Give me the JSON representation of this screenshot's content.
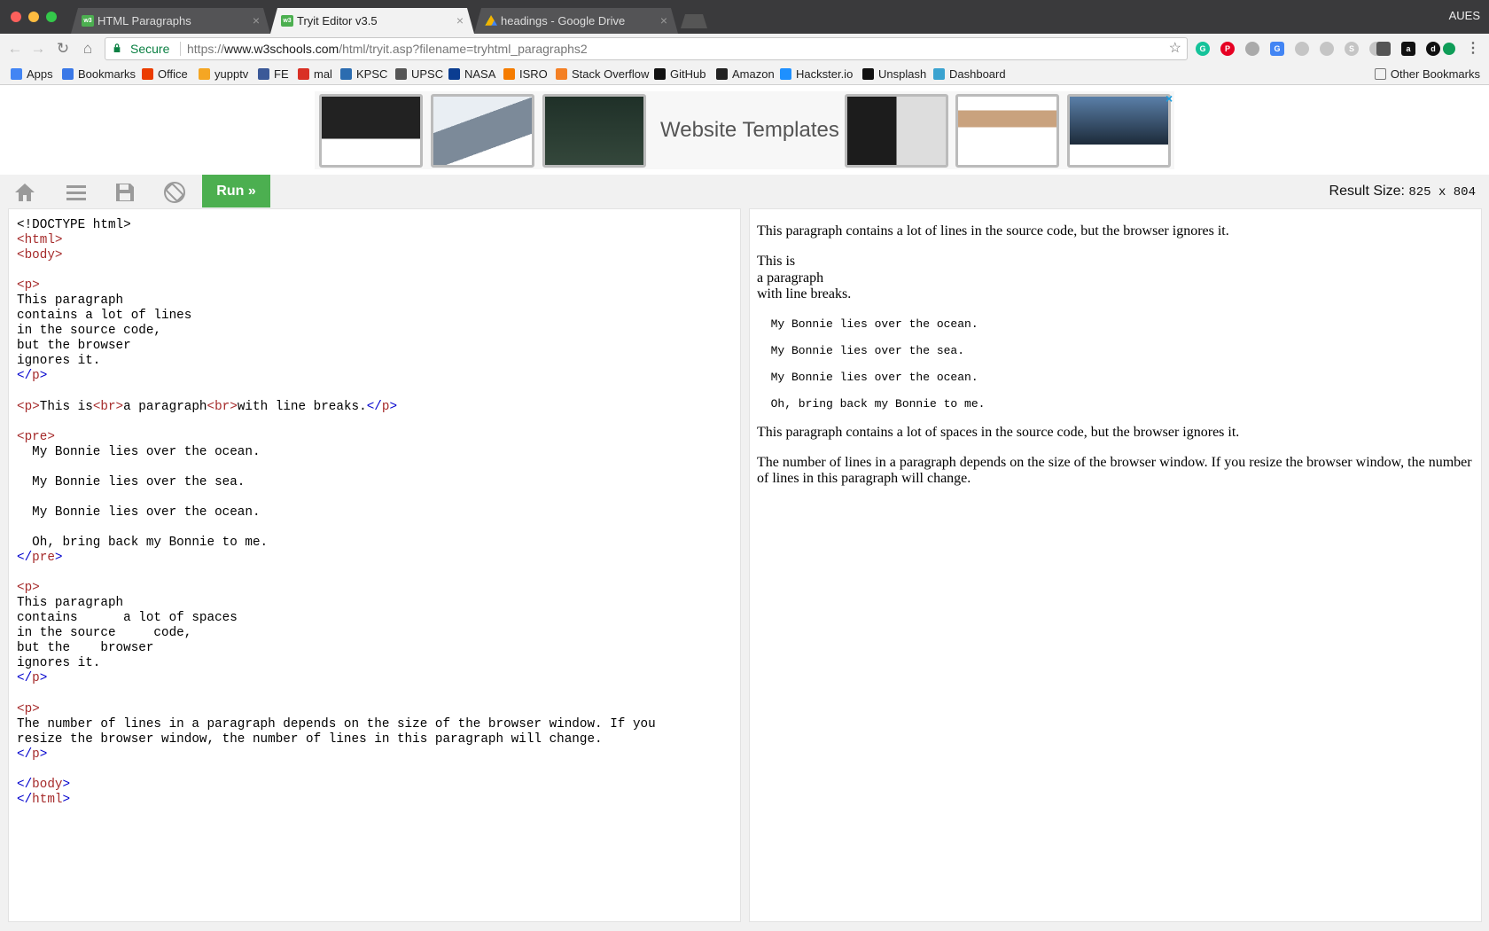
{
  "browser": {
    "tabs": [
      {
        "title": "HTML Paragraphs",
        "favicon": "w3schools-icon"
      },
      {
        "title": "Tryit Editor v3.5",
        "favicon": "w3schools-icon"
      },
      {
        "title": "headings - Google Drive",
        "favicon": "google-drive-icon"
      }
    ],
    "tab_close": "×",
    "profile": "AUES",
    "secure_label": "Secure",
    "url_scheme": "https://",
    "url_host": "www.w3schools.com",
    "url_path": "/html/tryit.asp?filename=tryhtml_paragraphs2"
  },
  "bookmarks": [
    {
      "label": "Apps",
      "color": "#4285f4"
    },
    {
      "label": "Bookmarks",
      "color": "#3a78e7"
    },
    {
      "label": "Office",
      "color": "#eb3c00"
    },
    {
      "label": "yupptv",
      "color": "#f5a623"
    },
    {
      "label": "FE",
      "color": "#3b5998"
    },
    {
      "label": "mal",
      "color": "#d93025"
    },
    {
      "label": "KPSC",
      "color": "#2b6cb0"
    },
    {
      "label": "UPSC",
      "color": "#555555"
    },
    {
      "label": "NASA",
      "color": "#0b3d91"
    },
    {
      "label": "ISRO",
      "color": "#f57c00"
    },
    {
      "label": "Stack Overflow",
      "color": "#f48024"
    },
    {
      "label": "GitHub",
      "color": "#111111"
    },
    {
      "label": "Amazon",
      "color": "#222222"
    },
    {
      "label": "Hackster.io",
      "color": "#1e90ff"
    },
    {
      "label": "Unsplash",
      "color": "#111111"
    },
    {
      "label": "Dashboard",
      "color": "#3ba3d0"
    }
  ],
  "other_bookmarks": "Other Bookmarks",
  "ad": {
    "title": "Website Templates",
    "close": "×"
  },
  "editor": {
    "run_label": "Run »",
    "result_size_label": "Result Size:",
    "result_size_value": "825 x 804"
  },
  "code_lines": [
    [
      [
        "t",
        "<!DOCTYPE html>"
      ]
    ],
    [
      [
        "g",
        "<html>"
      ]
    ],
    [
      [
        "g",
        "<body>"
      ]
    ],
    [],
    [
      [
        "g",
        "<p>"
      ]
    ],
    [
      [
        "t",
        "This paragraph"
      ]
    ],
    [
      [
        "t",
        "contains a lot of lines"
      ]
    ],
    [
      [
        "t",
        "in the source code,"
      ]
    ],
    [
      [
        "t",
        "but the browser"
      ]
    ],
    [
      [
        "t",
        "ignores it."
      ]
    ],
    [
      [
        "b",
        "</"
      ],
      [
        "g",
        "p"
      ],
      [
        "b",
        ">"
      ]
    ],
    [],
    [
      [
        "g",
        "<p>"
      ],
      [
        "t",
        "This is"
      ],
      [
        "g",
        "<br>"
      ],
      [
        "t",
        "a paragraph"
      ],
      [
        "g",
        "<br>"
      ],
      [
        "t",
        "with line breaks."
      ],
      [
        "b",
        "</"
      ],
      [
        "g",
        "p"
      ],
      [
        "b",
        ">"
      ]
    ],
    [],
    [
      [
        "g",
        "<pre>"
      ]
    ],
    [
      [
        "t",
        "  My Bonnie lies over the ocean."
      ]
    ],
    [],
    [
      [
        "t",
        "  My Bonnie lies over the sea."
      ]
    ],
    [],
    [
      [
        "t",
        "  My Bonnie lies over the ocean."
      ]
    ],
    [],
    [
      [
        "t",
        "  Oh, bring back my Bonnie to me."
      ]
    ],
    [
      [
        "b",
        "</"
      ],
      [
        "g",
        "pre"
      ],
      [
        "b",
        ">"
      ]
    ],
    [],
    [
      [
        "g",
        "<p>"
      ]
    ],
    [
      [
        "t",
        "This paragraph"
      ]
    ],
    [
      [
        "t",
        "contains      a lot of spaces"
      ]
    ],
    [
      [
        "t",
        "in the source     code,"
      ]
    ],
    [
      [
        "t",
        "but the    browser"
      ]
    ],
    [
      [
        "t",
        "ignores it."
      ]
    ],
    [
      [
        "b",
        "</"
      ],
      [
        "g",
        "p"
      ],
      [
        "b",
        ">"
      ]
    ],
    [],
    [
      [
        "g",
        "<p>"
      ]
    ],
    [
      [
        "t",
        "The number of lines in a paragraph depends on the size of the browser window. If you"
      ]
    ],
    [
      [
        "t",
        "resize the browser window, the number of lines in this paragraph will change."
      ]
    ],
    [
      [
        "b",
        "</"
      ],
      [
        "g",
        "p"
      ],
      [
        "b",
        ">"
      ]
    ],
    [],
    [
      [
        "b",
        "</"
      ],
      [
        "g",
        "body"
      ],
      [
        "b",
        ">"
      ]
    ],
    [
      [
        "b",
        "</"
      ],
      [
        "g",
        "html"
      ],
      [
        "b",
        ">"
      ]
    ]
  ],
  "result": {
    "p1": "This paragraph contains a lot of lines in the source code, but the browser ignores it.",
    "p2_lines": [
      "This is",
      "a paragraph",
      "with line breaks."
    ],
    "pre_text": "  My Bonnie lies over the ocean.\n\n  My Bonnie lies over the sea.\n\n  My Bonnie lies over the ocean.\n\n  Oh, bring back my Bonnie to me.",
    "p3": "This paragraph contains a lot of spaces in the source code, but the browser ignores it.",
    "p4": "The number of lines in a paragraph depends on the size of the browser window. If you resize the browser window, the number of lines in this paragraph will change."
  }
}
